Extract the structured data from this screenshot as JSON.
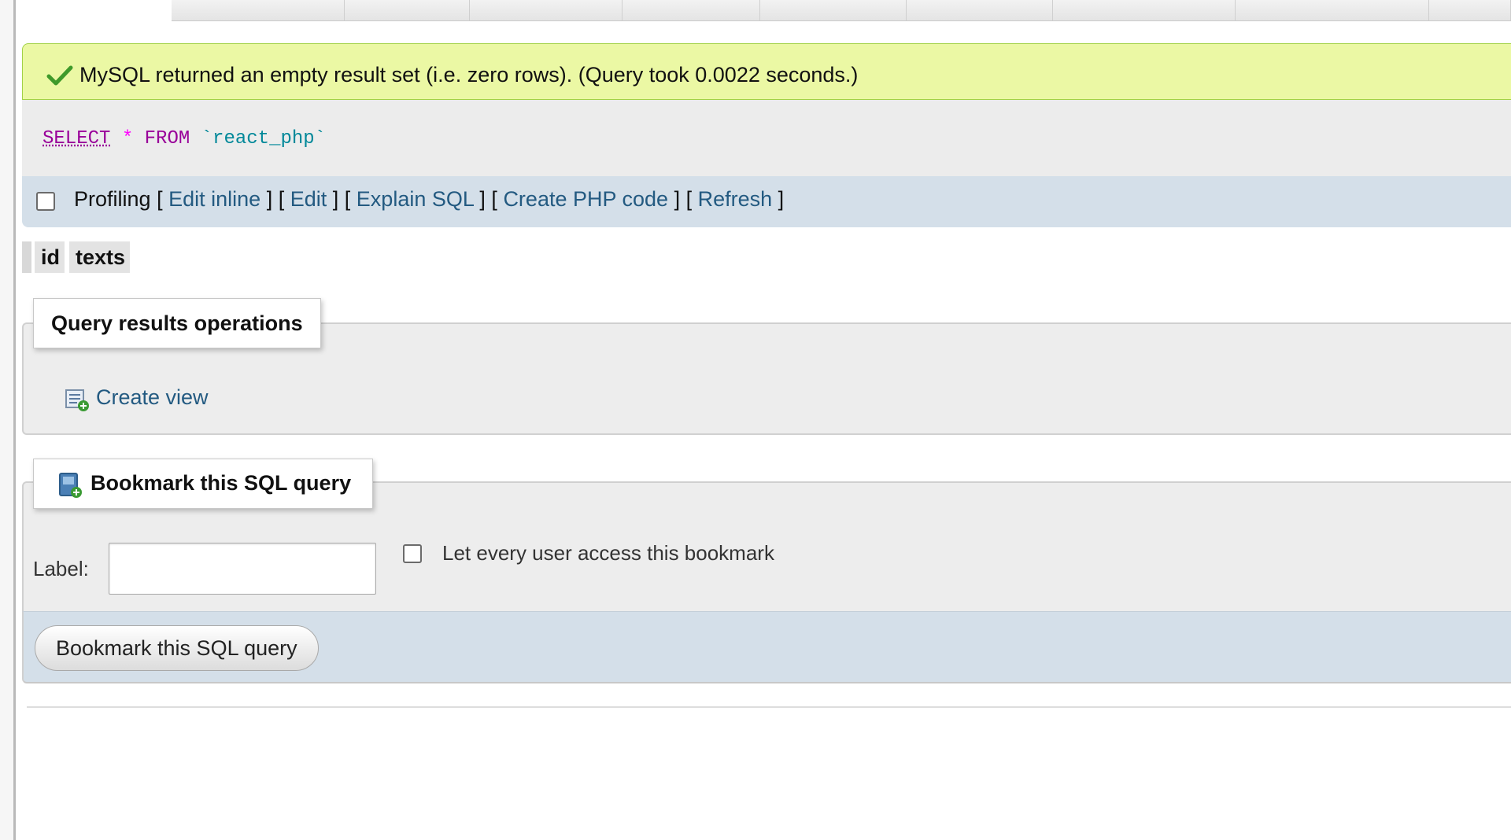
{
  "notice": {
    "text": "MySQL returned an empty result set (i.e. zero rows). (Query took 0.0022 seconds.)",
    "icon": "check-icon",
    "color": "#ebf8a4"
  },
  "sql": {
    "select": "SELECT",
    "star": "*",
    "from": "FROM",
    "table": "`react_php`"
  },
  "toolbar": {
    "profiling": "Profiling",
    "open": "[",
    "sep": "] [",
    "close": "]",
    "edit_inline": "Edit inline",
    "edit": "Edit",
    "explain_sql": "Explain SQL",
    "create_php_code": "Create PHP code",
    "refresh": "Refresh"
  },
  "columns": [
    "id",
    "texts"
  ],
  "query_ops": {
    "legend": "Query results operations",
    "create_view": "Create view",
    "icon": "create-view-icon"
  },
  "bookmark": {
    "legend": "Bookmark this SQL query",
    "legend_icon": "bookmark-icon",
    "label_text": "Label:",
    "label_value": "",
    "share_text": "Let every user access this bookmark",
    "button": "Bookmark this SQL query"
  },
  "colors": {
    "link": "#235a81",
    "toolbar_bg": "#d4dfe9",
    "panel_bg": "#ececec"
  }
}
